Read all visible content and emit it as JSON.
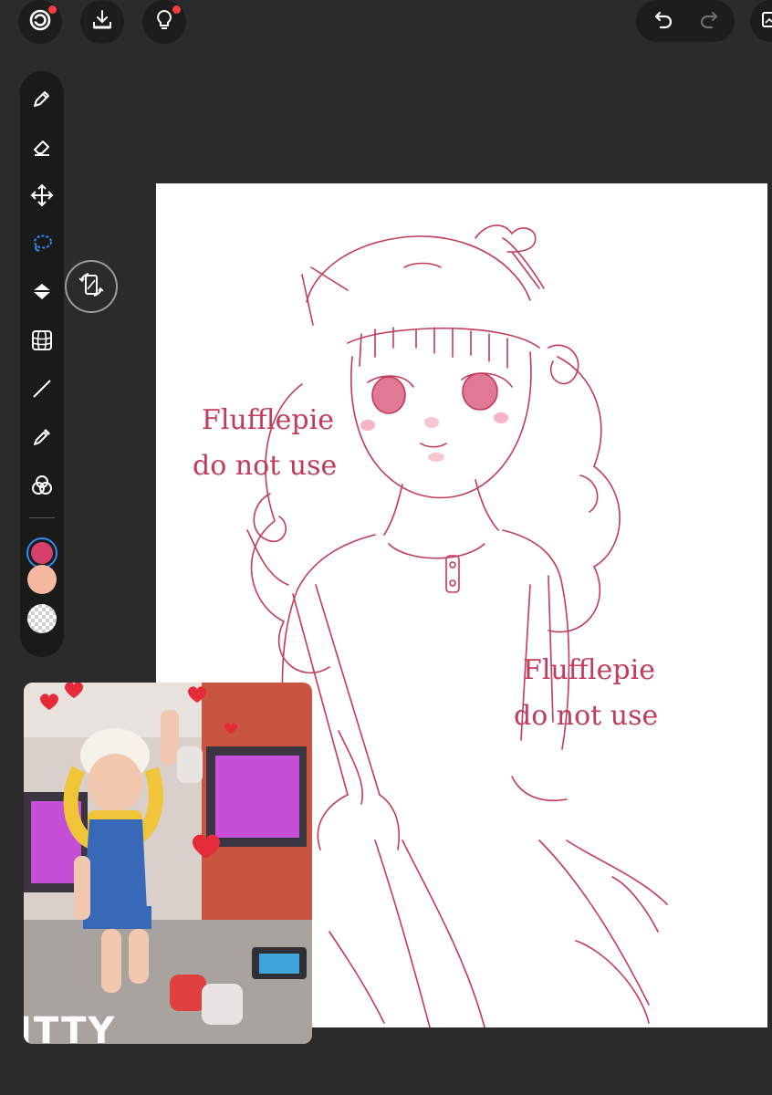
{
  "top_bar": {
    "left_buttons": [
      {
        "icon": "gallery-swirl-icon",
        "badge": true
      },
      {
        "icon": "import-tray-icon",
        "badge": false
      },
      {
        "icon": "lightbulb-tips-icon",
        "badge": true
      }
    ],
    "right": {
      "undo_icon": "undo-icon",
      "redo_icon": "redo-icon",
      "layers_icon": "layers-icon"
    }
  },
  "toolbar": {
    "tools": [
      "pen-icon",
      "eraser-icon",
      "move-icon",
      "lasso-icon",
      "fill-bucket-icon",
      "grid-transform-icon",
      "line-icon",
      "eyedropper-icon",
      "color-blend-icon"
    ],
    "active_tool": "lasso-icon",
    "colors": {
      "primary": "#d63f6b",
      "secondary": "#f5b8a0",
      "tertiary": "transparent"
    }
  },
  "canvas": {
    "watermark_1_line1": "Flufflepie",
    "watermark_1_line2": "do not use",
    "watermark_2_line1": "Flufflepie",
    "watermark_2_line2": "do not use",
    "stroke_color": "#c23a5c"
  },
  "reference": {
    "caption": "ITTY"
  }
}
